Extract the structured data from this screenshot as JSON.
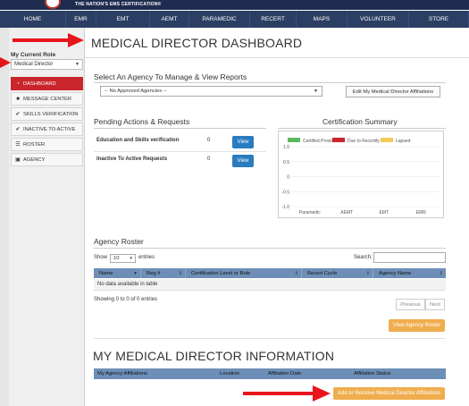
{
  "header": {
    "tagline": "THE NATION'S EMS CERTIFICATION®"
  },
  "nav": [
    "HOME",
    "EMR",
    "EMT",
    "AEMT",
    "PARAMEDIC",
    "RECERT",
    "MAPS",
    "VOLUNTEER",
    "STORE"
  ],
  "sidebar": {
    "role_label": "My Current Role",
    "role_value": "Medical Director",
    "items": [
      {
        "label": "DASHBOARD",
        "icon": "dashboard-icon",
        "glyph": "◔",
        "active": true
      },
      {
        "label": "MESSAGE CENTER",
        "icon": "message-icon",
        "glyph": "■",
        "active": false
      },
      {
        "label": "SKILLS VERIFICATION",
        "icon": "check-icon",
        "glyph": "✔",
        "active": false
      },
      {
        "label": "INACTIVE TO ACTIVE",
        "icon": "check-icon",
        "glyph": "✔",
        "active": false
      },
      {
        "label": "ROSTER",
        "icon": "list-icon",
        "glyph": "☰",
        "active": false
      },
      {
        "label": "AGENCY",
        "icon": "building-icon",
        "glyph": "▣",
        "active": false
      }
    ]
  },
  "page": {
    "title": "MEDICAL DIRECTOR DASHBOARD"
  },
  "agency": {
    "section_title": "Select An Agency To Manage & View Reports",
    "select_value": "-- No Approved Agencies --",
    "edit_button": "Edit My Medical Director Affiliations"
  },
  "pending": {
    "title": "Pending Actions & Requests",
    "rows": [
      {
        "label": "Education and Skills verification",
        "count": "0",
        "button": "View"
      },
      {
        "label": "Inactive To Active Requests",
        "count": "0",
        "button": "View"
      }
    ]
  },
  "cert_summary": {
    "title": "Certification Summary"
  },
  "chart_data": {
    "type": "bar",
    "title": "Certification Summary",
    "categories": [
      "Paramedic",
      "AEMT",
      "EMT",
      "EMR"
    ],
    "series": [
      {
        "name": "Certified Providers",
        "color": "#5cb85c",
        "values": [
          0,
          0,
          0,
          0
        ]
      },
      {
        "name": "Due to Recertify",
        "color": "#c9252c",
        "values": [
          0,
          0,
          0,
          0
        ]
      },
      {
        "name": "Lapsed",
        "color": "#f5c95c",
        "values": [
          0,
          0,
          0,
          0
        ]
      }
    ],
    "ylim": [
      -1.0,
      1.0
    ],
    "yticks": [
      "1.0",
      "0.5",
      "0",
      "-0.5",
      "-1.0"
    ],
    "legend": "top"
  },
  "roster": {
    "title": "Agency Roster",
    "show_label": "Show",
    "entries_label": "entries",
    "length_value": "10",
    "search_label": "Search:",
    "columns": [
      "Name",
      "Reg #",
      "Certification Level or Role",
      "Recert Cycle",
      "Agency Name"
    ],
    "empty_text": "No data available in table",
    "info_text": "Showing 0 to 0 of 0 entries",
    "previous": "Previous",
    "next": "Next",
    "view_button": "View Agency Roster"
  },
  "md_info": {
    "title": "MY MEDICAL DIRECTOR INFORMATION",
    "columns": [
      "My Agency Affiliations",
      "Location",
      "Affiliation Date",
      "Affiliation Status"
    ],
    "button": "Add or Remove Medical Director Affiliations"
  }
}
